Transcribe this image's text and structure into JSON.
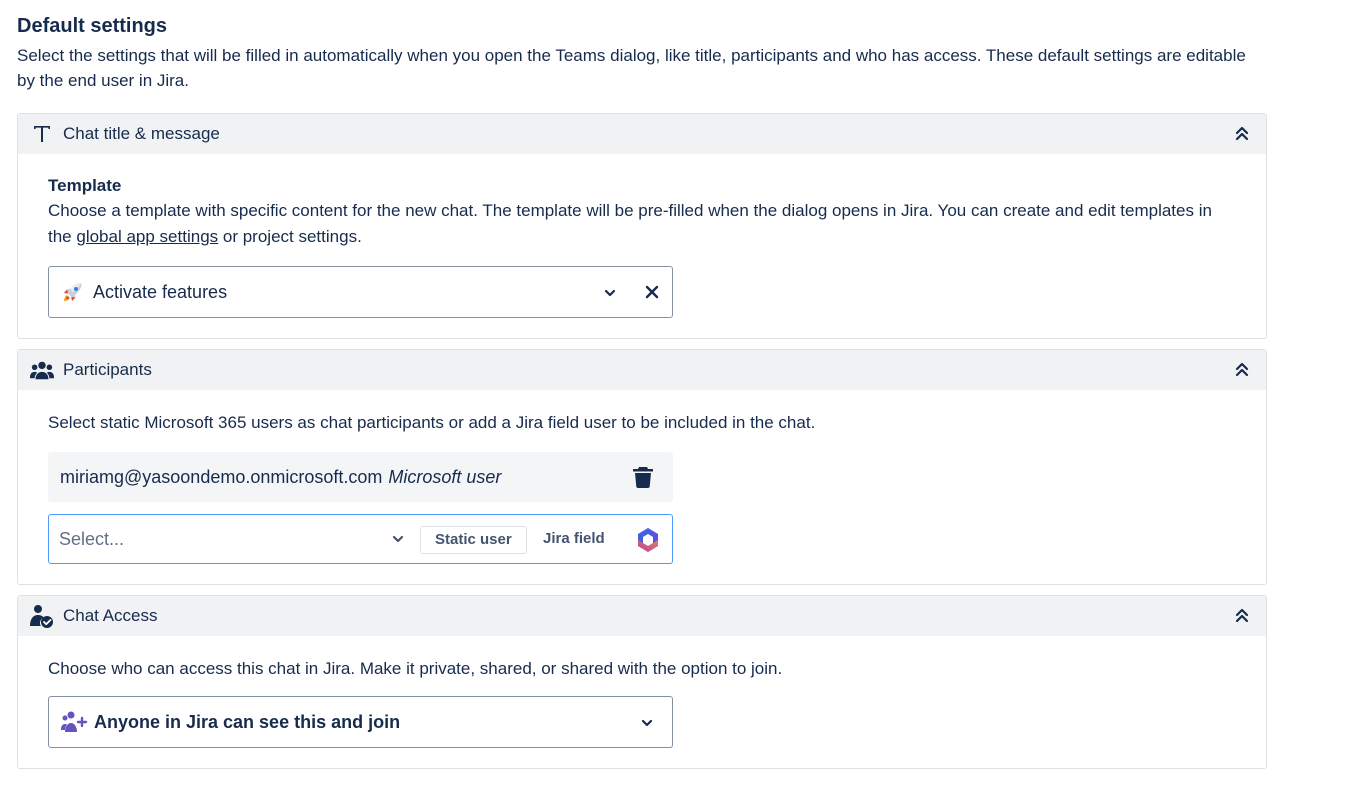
{
  "page": {
    "title": "Default settings",
    "description": "Select the settings that will be filled in automatically when you open the Teams dialog, like title, participants and who has access. These default settings are editable by the end user in Jira."
  },
  "chat_title_panel": {
    "title": "Chat title & message",
    "icon": "text-t-icon",
    "template_label": "Template",
    "template_help_before": "Choose a template with specific content for the new chat. The template will be pre-filled when the dialog opens in Jira. You can create and edit templates in the",
    "template_help_link": "global app settings",
    "template_help_after": "or project settings.",
    "template_value": "Activate features",
    "template_icon": "rocket-icon"
  },
  "participants_panel": {
    "title": "Participants",
    "icon": "people-group-icon",
    "help": "Select static Microsoft 365 users as chat participants or add a Jira field user to be included in the chat.",
    "users": [
      {
        "email": "miriamg@yasoondemo.onmicrosoft.com",
        "type": "Microsoft user"
      }
    ],
    "picker_placeholder": "Select...",
    "static_user_label": "Static user",
    "jira_field_label": "Jira field"
  },
  "access_panel": {
    "title": "Chat Access",
    "icon": "person-check-icon",
    "help": "Choose who can access this chat in Jira. Make it private, shared, or shared with the option to join.",
    "value": "Anyone in Jira can see this and join"
  },
  "colors": {
    "text": "#172b4d",
    "header_bg": "#f1f2f4",
    "border": "#dfe1e6",
    "focus": "#4c9aff",
    "accent_purple": "#6554c0"
  }
}
